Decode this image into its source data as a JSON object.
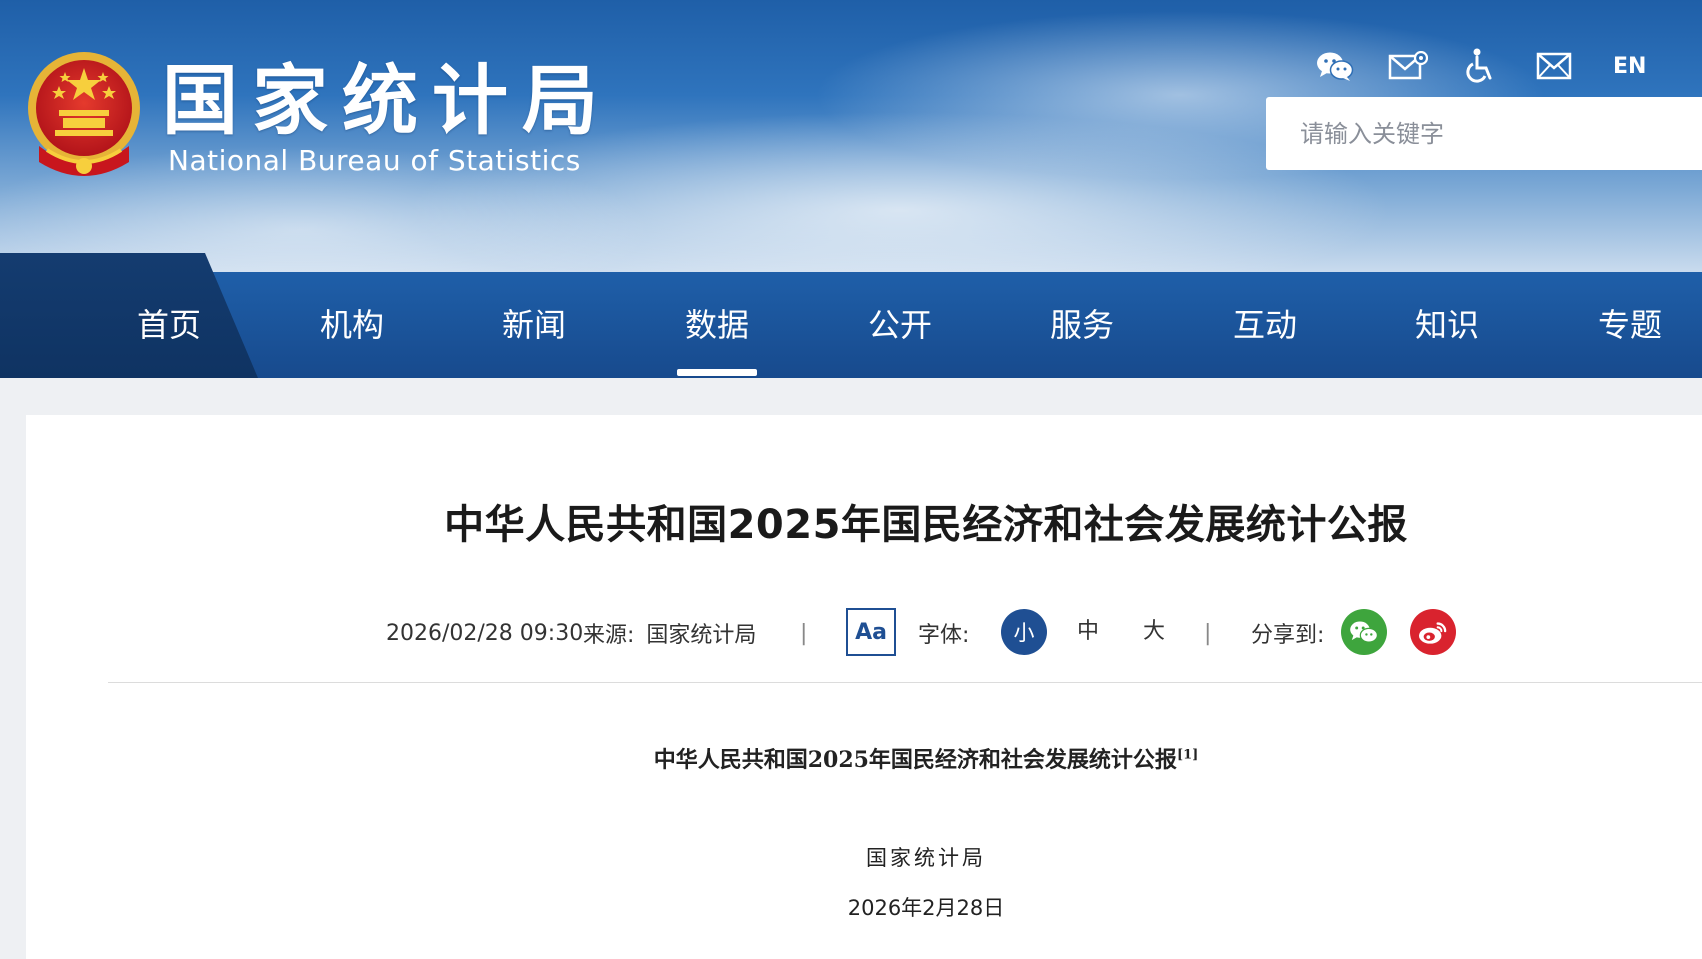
{
  "header": {
    "logo_cn": "国家统计局",
    "logo_en": "National Bureau of Statistics",
    "utility": {
      "wechat_icon": "wechat-icon",
      "mail_service_icon": "mail-settings-icon",
      "accessibility_icon": "accessibility-icon",
      "mailbox_icon": "mail-icon",
      "en_label": "EN"
    },
    "search": {
      "placeholder": "请输入关键字",
      "value": ""
    }
  },
  "nav": {
    "items": [
      {
        "label": "首页"
      },
      {
        "label": "机构"
      },
      {
        "label": "新闻"
      },
      {
        "label": "数据"
      },
      {
        "label": "公开"
      },
      {
        "label": "服务"
      },
      {
        "label": "互动"
      },
      {
        "label": "知识"
      },
      {
        "label": "专题"
      }
    ],
    "active": "数据"
  },
  "article": {
    "title": "中华人民共和国2025年国民经济和社会发展统计公报",
    "meta": {
      "datetime": "2026/02/28 09:30",
      "source_label": "来源:",
      "source": "国家统计局",
      "separator": "|",
      "aa_label": "Aa",
      "font_label": "字体:",
      "font_small": "小",
      "font_medium": "中",
      "font_large": "大",
      "share_label": "分享到:"
    },
    "doc_title": "中华人民共和国2025年国民经济和社会发展统计公报",
    "doc_title_note": "[1]",
    "doc_org": "国家统计局",
    "doc_date": "2026年2月28日"
  },
  "colors": {
    "nav_bg": "#1d5aa2",
    "nav_home_bg": "#113566",
    "accent_blue": "#1f4f93",
    "wechat_green": "#3ea53d",
    "weibo_red": "#d9232e"
  }
}
